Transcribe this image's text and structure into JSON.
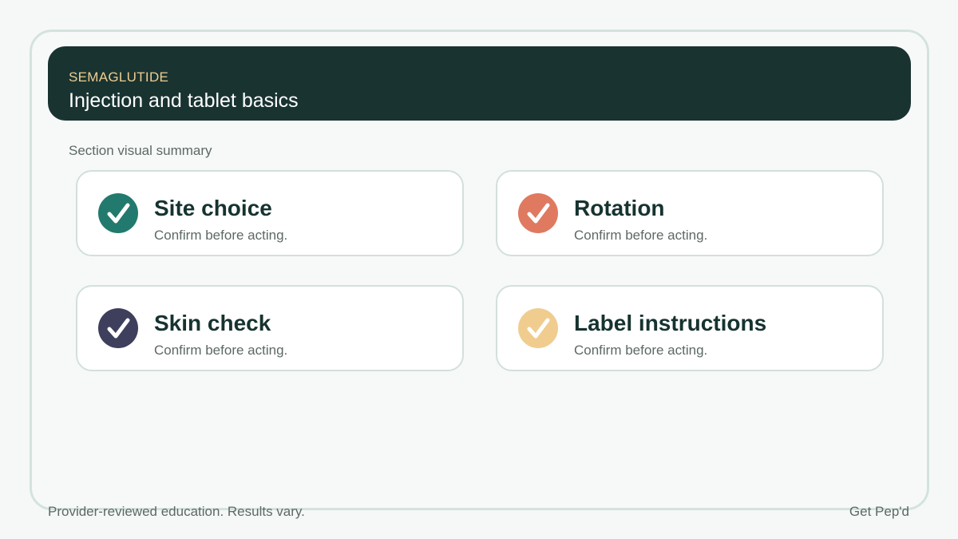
{
  "header": {
    "eyebrow": "SEMAGLUTIDE",
    "title": "Injection and tablet basics"
  },
  "section_label": "Section visual summary",
  "cards": [
    {
      "title": "Site choice",
      "subtitle": "Confirm before acting.",
      "icon": "check-icon",
      "color": "#227a6e"
    },
    {
      "title": "Rotation",
      "subtitle": "Confirm before acting.",
      "icon": "check-icon",
      "color": "#df7a60"
    },
    {
      "title": "Skin check",
      "subtitle": "Confirm before acting.",
      "icon": "check-icon",
      "color": "#3e3f5c"
    },
    {
      "title": "Label instructions",
      "subtitle": "Confirm before acting.",
      "icon": "check-icon",
      "color": "#f0cd8f"
    }
  ],
  "footer": {
    "disclaimer": "Provider-reviewed education. Results vary.",
    "brand": "Get Pep'd"
  }
}
